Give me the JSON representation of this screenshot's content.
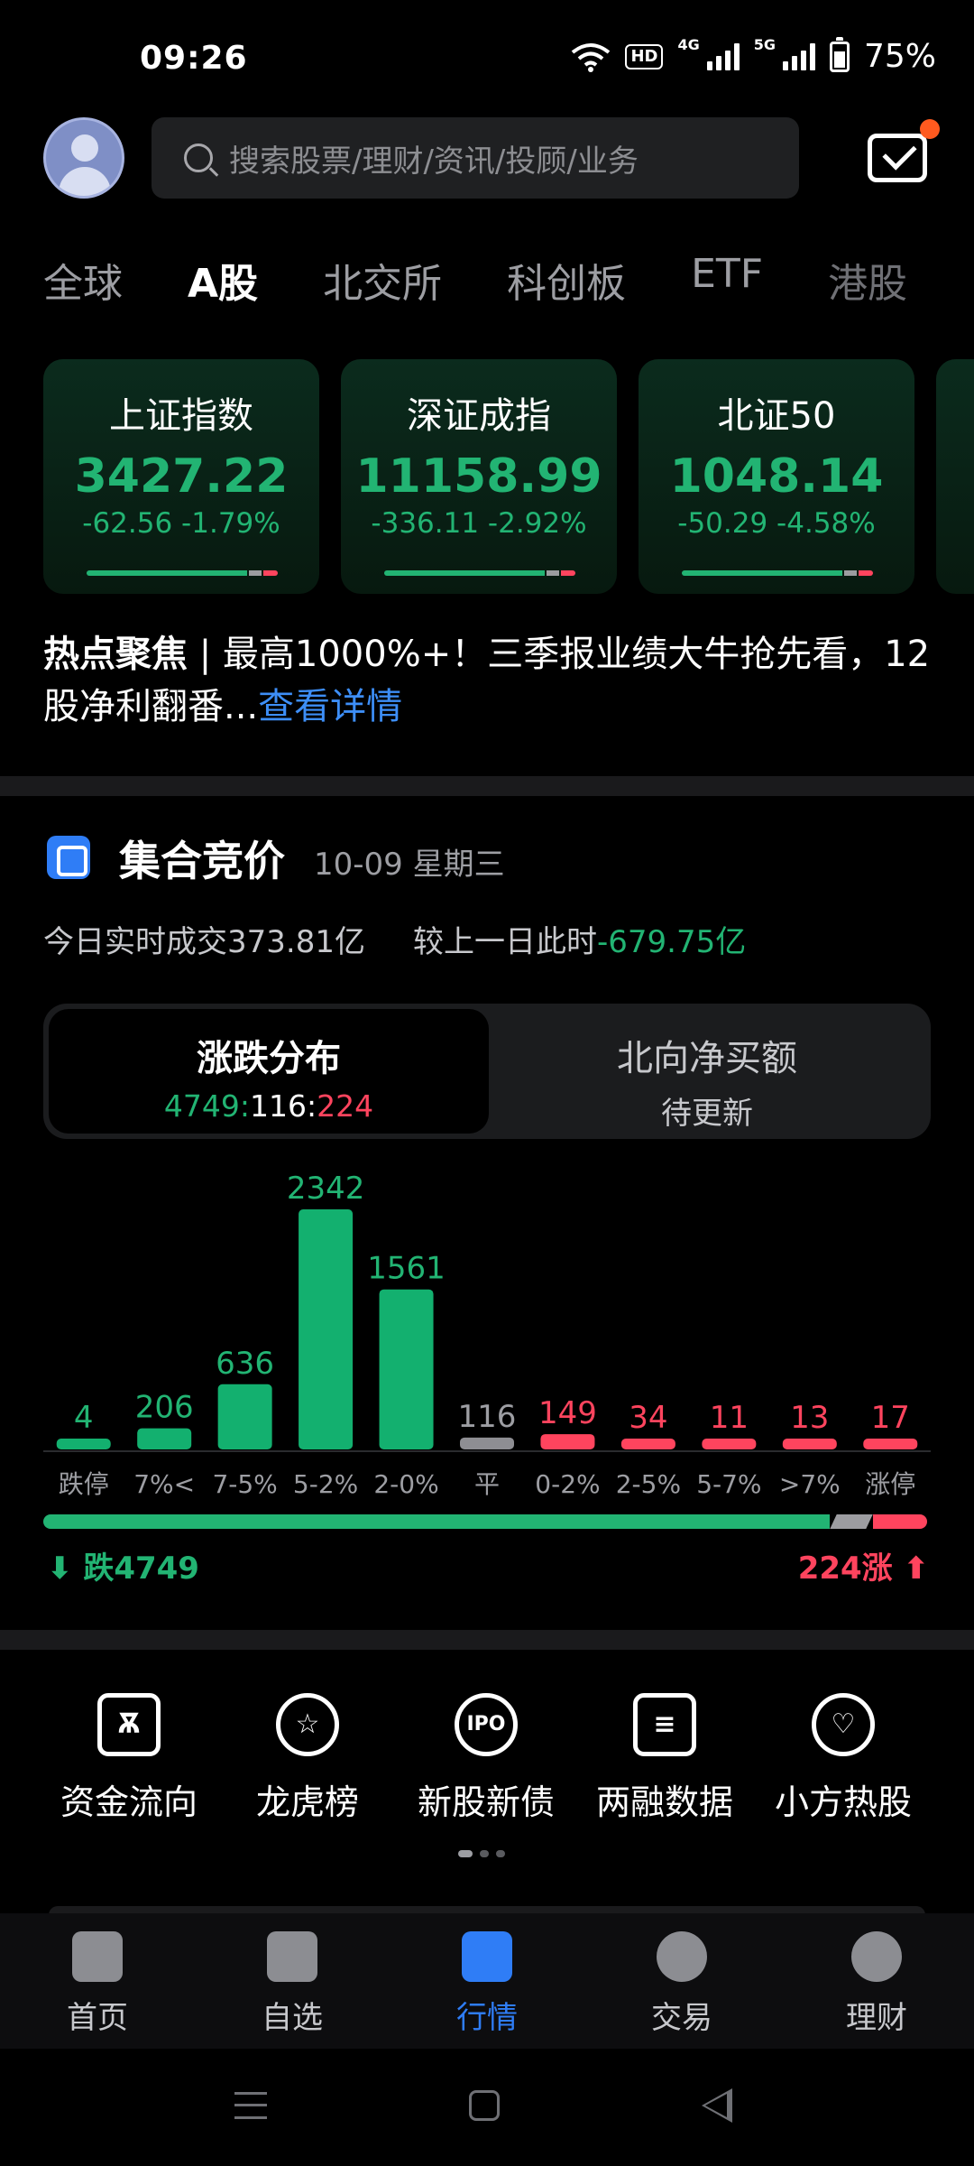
{
  "status": {
    "time": "09:26",
    "battery": "75%",
    "net1": "4G",
    "net2": "5G",
    "hd": "HD"
  },
  "header": {
    "search_placeholder": "搜索股票/理财/资讯/投顾/业务"
  },
  "tabs": [
    {
      "label": "全球"
    },
    {
      "label": "A股"
    },
    {
      "label": "北交所"
    },
    {
      "label": "科创板"
    },
    {
      "label": "ETF"
    },
    {
      "label": "港股"
    }
  ],
  "indices": [
    {
      "name": "上证指数",
      "value": "3427.22",
      "change": "-62.56 -1.79%"
    },
    {
      "name": "深证成指",
      "value": "11158.99",
      "change": "-336.11 -2.92%"
    },
    {
      "name": "北证50",
      "value": "1048.14",
      "change": "-50.29 -4.58%"
    }
  ],
  "hot_news": {
    "tag": "热点聚焦",
    "text": " | 最高1000%+！三季报业绩大牛抢先看，12股净利翻番...",
    "more": "查看详情"
  },
  "auction": {
    "title": "集合竞价",
    "date": "10-09 星期三",
    "today_label": "今日实时成交",
    "today_value": "373.81亿",
    "compare_label": "较上一日此时",
    "compare_value": "-679.75亿",
    "seg_a_title": "涨跌分布",
    "seg_a_fall": "4749",
    "seg_a_flat": "116",
    "seg_a_rise": "224",
    "sep": ":",
    "seg_b_title": "北向净买额",
    "seg_b_value": "待更新",
    "fall_label": "跌4749",
    "rise_label": "224涨"
  },
  "chart_data": {
    "type": "bar",
    "categories": [
      "跌停",
      "7%<",
      "7-5%",
      "5-2%",
      "2-0%",
      "平",
      "0-2%",
      "2-5%",
      "5-7%",
      ">7%",
      "涨停"
    ],
    "values": [
      4,
      206,
      636,
      2342,
      1561,
      116,
      149,
      34,
      11,
      13,
      17
    ],
    "bar_colors": [
      "#13b06f",
      "#13b06f",
      "#13b06f",
      "#13b06f",
      "#13b06f",
      "#8e8e93",
      "#ff445e",
      "#ff445e",
      "#ff445e",
      "#ff445e",
      "#ff445e"
    ],
    "label_colors": [
      "#22b473",
      "#22b473",
      "#22b473",
      "#22b473",
      "#22b473",
      "#9d9ea3",
      "#ff445e",
      "#ff445e",
      "#ff445e",
      "#ff445e",
      "#ff445e"
    ],
    "ylim": [
      0,
      2342
    ]
  },
  "shortcuts": [
    {
      "label": "资金流向",
      "icon": "fund-flow-icon",
      "glyph": "Ѫ"
    },
    {
      "label": "龙虎榜",
      "icon": "medal-icon",
      "glyph": "☆"
    },
    {
      "label": "新股新债",
      "icon": "ipo-icon",
      "glyph": "IPO"
    },
    {
      "label": "两融数据",
      "icon": "margin-data-icon",
      "glyph": "≡"
    },
    {
      "label": "小方热股",
      "icon": "hot-stock-icon",
      "glyph": "♡"
    }
  ],
  "bottom_nav": [
    {
      "label": "首页",
      "icon": "home-icon"
    },
    {
      "label": "自选",
      "icon": "watchlist-add-icon"
    },
    {
      "label": "行情",
      "icon": "market-chart-icon"
    },
    {
      "label": "交易",
      "icon": "yen-icon"
    },
    {
      "label": "理财",
      "icon": "diamond-icon"
    }
  ],
  "colors": {
    "fall": "#22b473",
    "rise": "#ff445e",
    "flat": "#9c9ca0",
    "accent": "#2f7df6"
  }
}
